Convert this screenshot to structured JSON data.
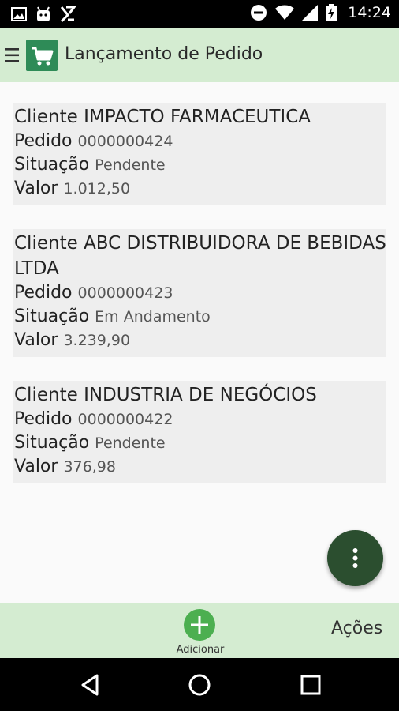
{
  "status_bar": {
    "time": "14:24",
    "left_icons": [
      "image-icon",
      "android-icon",
      "app-icon"
    ],
    "right_icons": [
      "do-not-disturb-icon",
      "wifi-icon",
      "signal-icon",
      "battery-charging-icon"
    ]
  },
  "app_bar": {
    "menu_icon": "menu-icon",
    "logo_icon": "shopping-cart-icon",
    "title": "Lançamento de Pedido"
  },
  "labels": {
    "cliente": "Cliente",
    "pedido": "Pedido",
    "situacao": "Situação",
    "valor": "Valor"
  },
  "orders": [
    {
      "cliente": "IMPACTO FARMACEUTICA",
      "pedido": "0000000424",
      "situacao": "Pendente",
      "valor": "1.012,50"
    },
    {
      "cliente": "ABC DISTRIBUIDORA DE BEBIDAS LTDA",
      "pedido": "0000000423",
      "situacao": "Em Andamento",
      "valor": "3.239,90"
    },
    {
      "cliente": "INDUSTRIA DE NEGÓCIOS",
      "pedido": "0000000422",
      "situacao": "Pendente",
      "valor": "376,98"
    }
  ],
  "fab": {
    "icon": "more-vertical-icon"
  },
  "bottom_bar": {
    "add_label": "Adicionar",
    "add_icon": "plus-icon",
    "actions_label": "Ações"
  },
  "nav_bar": {
    "icons": [
      "back-icon",
      "home-icon",
      "recents-icon"
    ]
  },
  "colors": {
    "accent_light": "#d4ecd1",
    "card": "#eeeeee",
    "fab": "#2b4e2f",
    "add_button": "#4caf50",
    "logo": "#2e8b57"
  }
}
